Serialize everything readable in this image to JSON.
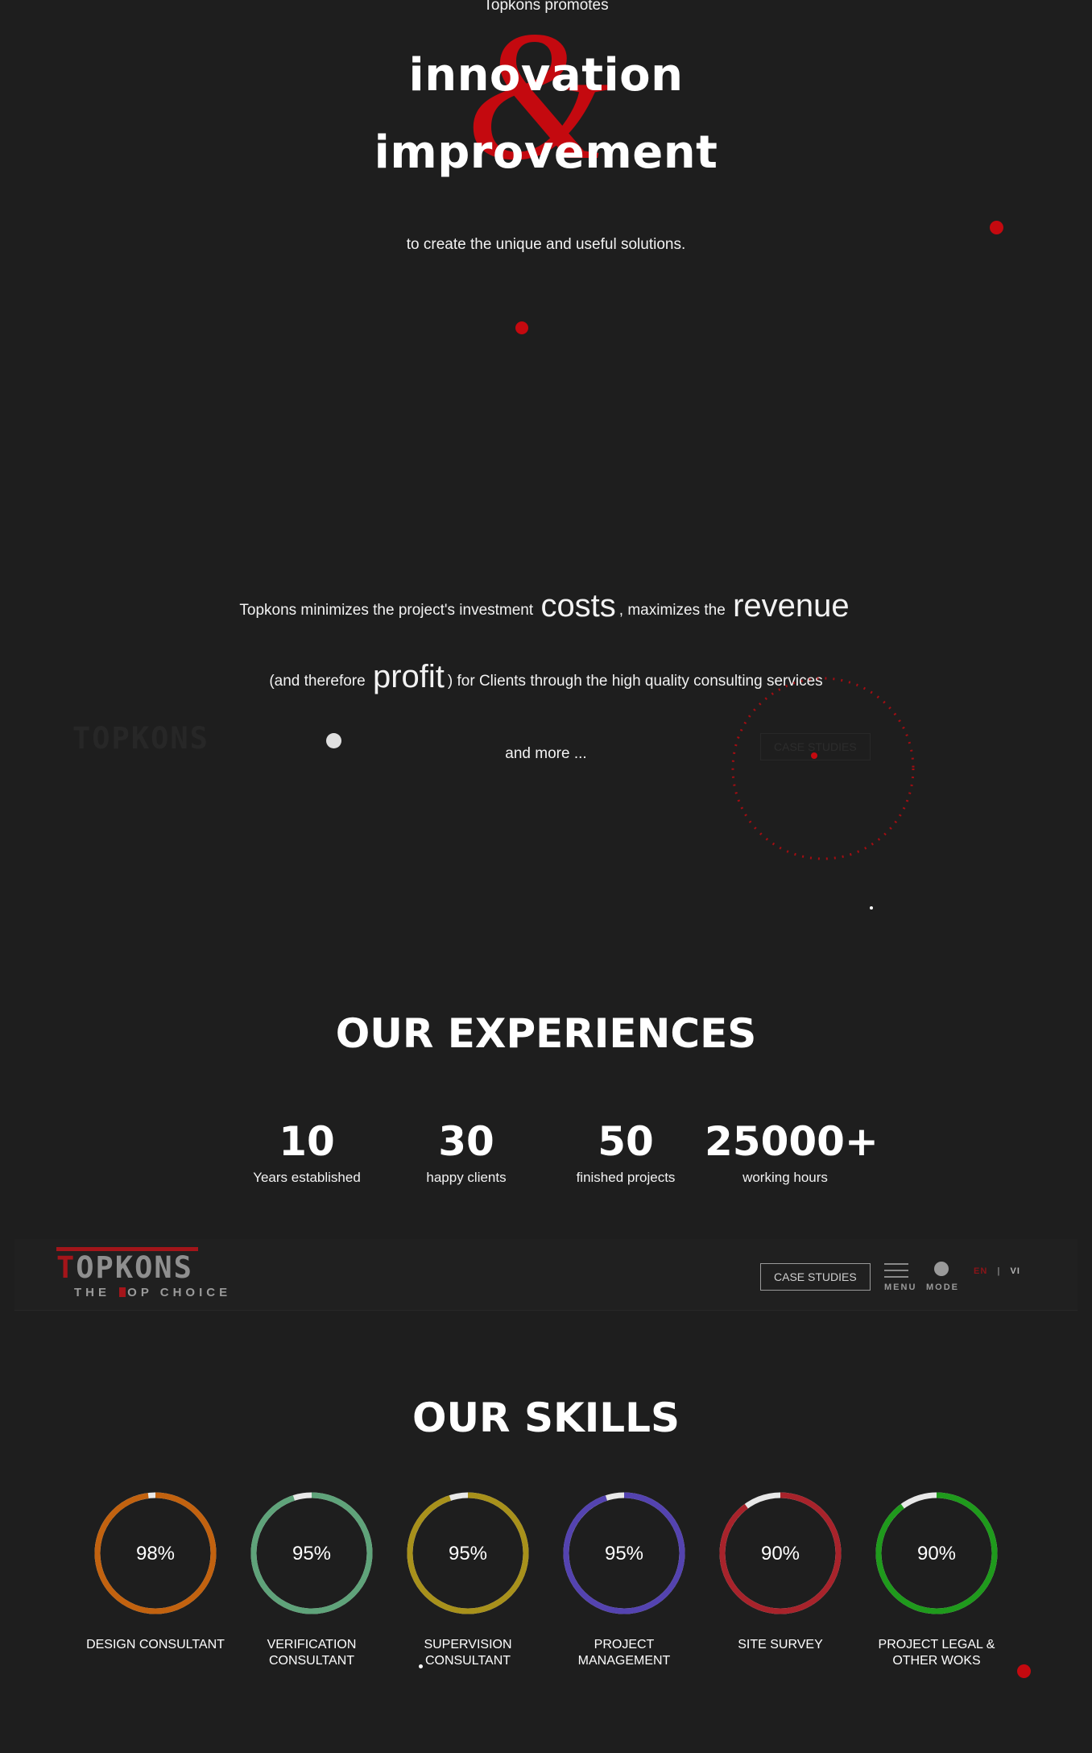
{
  "hero": {
    "promotes": "Topkons promotes",
    "ampersand": "&",
    "word1": "innovation",
    "word2": "improvement",
    "tagline": "to create the unique and useful solutions."
  },
  "minimizes": {
    "p1": "Topkons minimizes the project's investment",
    "costs": "costs",
    "p2": ", maximizes the",
    "revenue": "revenue",
    "p3": "(and therefore",
    "profit": "profit",
    "p4": ") for Clients through the high quality consulting services",
    "more": "and more ..."
  },
  "experiences": {
    "title": "OUR EXPERIENCES",
    "stats": [
      {
        "value": "10",
        "label": "Years established"
      },
      {
        "value": "30",
        "label": "happy clients"
      },
      {
        "value": "50",
        "label": "finished projects"
      },
      {
        "value": "25000+",
        "label": "working hours"
      }
    ]
  },
  "header": {
    "logo_main": "OPKONS",
    "logo_initial": "T",
    "logo_sub_a": "THE",
    "logo_sub_b": "OP CHOICE",
    "case_studies": "CASE STUDIES",
    "menu_label": "MENU",
    "mode_label": "MODE",
    "lang_en": "EN",
    "lang_sep": "|",
    "lang_vi": "VI",
    "colors": {
      "accent": "#a3151a"
    }
  },
  "skills": {
    "title": "OUR SKILLS",
    "items": [
      {
        "percent_text": "98%",
        "value": 98,
        "label": "DESIGN CONSULTANT",
        "color": "#c2620f"
      },
      {
        "percent_text": "95%",
        "value": 95,
        "label": "VERIFICATION CONSULTANT",
        "color": "#5fa37a"
      },
      {
        "percent_text": "95%",
        "value": 95,
        "label": "SUPERVISION CONSULTANT",
        "color": "#a8911b"
      },
      {
        "percent_text": "95%",
        "value": 95,
        "label": "PROJECT MANAGEMENT",
        "color": "#5443b0"
      },
      {
        "percent_text": "90%",
        "value": 90,
        "label": "SITE SURVEY",
        "color": "#a8232b"
      },
      {
        "percent_text": "90%",
        "value": 90,
        "label": "PROJECT LEGAL & OTHER WOKS",
        "color": "#1f9a1c"
      }
    ]
  }
}
